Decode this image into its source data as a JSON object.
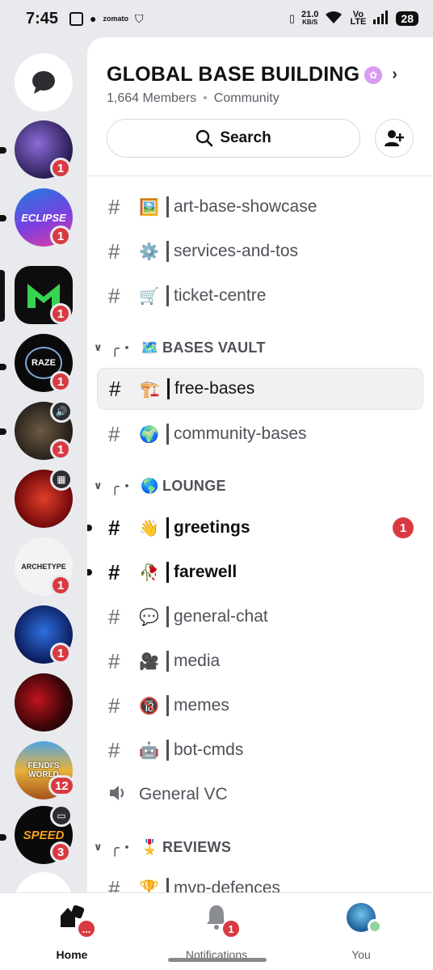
{
  "status": {
    "time": "7:45",
    "speed_value": "21.0",
    "speed_unit": "KB/S",
    "network": "Vo LTE",
    "battery": "28"
  },
  "rail": {
    "servers": [
      {
        "name": "direct-messages",
        "badge": ""
      },
      {
        "name": "server-1",
        "badge": "1"
      },
      {
        "name": "server-eclipse",
        "badge": "1"
      },
      {
        "name": "server-m",
        "badge": "1"
      },
      {
        "name": "server-raze",
        "badge": "1"
      },
      {
        "name": "server-5",
        "badge": "1"
      },
      {
        "name": "server-6",
        "badge": ""
      },
      {
        "name": "server-archetype",
        "badge": "1"
      },
      {
        "name": "server-8",
        "badge": "1"
      },
      {
        "name": "server-9",
        "badge": ""
      },
      {
        "name": "server-fendis-world",
        "badge": "12"
      },
      {
        "name": "server-speed",
        "badge": "3"
      }
    ],
    "logo_texts": {
      "eclipse": "ECLIPSE",
      "raze": "RAZE",
      "archetype": "ARCHETYPE",
      "fendi": "FENDI'S WORLD",
      "speed": "SPEED"
    }
  },
  "guild": {
    "title": "GLOBAL BASE BUILDING",
    "members": "1,664 Members",
    "type": "Community"
  },
  "search": {
    "label": "Search"
  },
  "channels": [
    {
      "emoji": "🖼️",
      "name": "art-base-showcase"
    },
    {
      "emoji": "⚙️",
      "name": "services-and-tos"
    },
    {
      "emoji": "🛒",
      "name": "ticket-centre"
    }
  ],
  "categories": [
    {
      "deco": "╭・",
      "emoji": "🗺️",
      "label": "BASES VAULT"
    },
    {
      "deco": "╭・",
      "emoji": "🌎",
      "label": "LOUNGE"
    },
    {
      "deco": "╭・",
      "emoji": "🎖️",
      "label": "REVIEWS"
    }
  ],
  "bases_channels": [
    {
      "emoji": "🏗️",
      "name": "free-bases"
    },
    {
      "emoji": "🌍",
      "name": "community-bases"
    }
  ],
  "lounge_channels": [
    {
      "emoji": "👋",
      "name": "greetings",
      "badge": "1"
    },
    {
      "emoji": "🥀",
      "name": "farewell"
    },
    {
      "emoji": "💬",
      "name": "general-chat"
    },
    {
      "emoji": "🎥",
      "name": "media"
    },
    {
      "emoji": "🔞",
      "name": "memes"
    },
    {
      "emoji": "🤖",
      "name": "bot-cmds"
    }
  ],
  "voice": {
    "name": "General VC"
  },
  "reviews_channels": [
    {
      "emoji": "🏆",
      "name": "mvp-defences"
    }
  ],
  "nav": {
    "home": "Home",
    "home_badge": "...",
    "notifications": "Notifications",
    "notif_badge": "1",
    "you": "You"
  }
}
